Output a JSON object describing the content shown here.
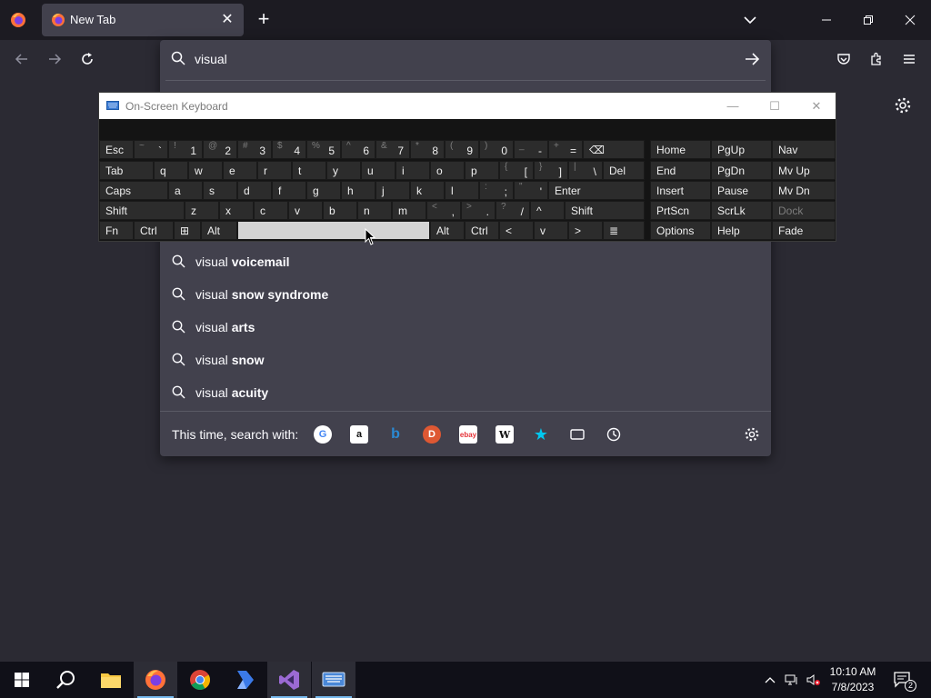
{
  "browser": {
    "tab": {
      "title": "New Tab"
    },
    "url": {
      "value": "visual"
    }
  },
  "suggestions": [
    {
      "prefix": "visual",
      "completion": "voicemail"
    },
    {
      "prefix": "visual",
      "completion": "snow syndrome"
    },
    {
      "prefix": "visual",
      "completion": "arts"
    },
    {
      "prefix": "visual",
      "completion": "snow"
    },
    {
      "prefix": "visual",
      "completion": "acuity"
    }
  ],
  "search_with": {
    "label": "This time, search with:",
    "engines": [
      "google-icon",
      "amazon-icon",
      "bing-icon",
      "duckduckgo-icon",
      "ebay-icon",
      "wikipedia-icon",
      "bookmarks-icon",
      "tabs-icon",
      "history-icon"
    ]
  },
  "osk": {
    "title": "On-Screen Keyboard",
    "rows": [
      [
        {
          "l": "Esc"
        },
        {
          "s": "~",
          "m": "`"
        },
        {
          "s": "!",
          "m": "1"
        },
        {
          "s": "@",
          "m": "2"
        },
        {
          "s": "#",
          "m": "3"
        },
        {
          "s": "$",
          "m": "4"
        },
        {
          "s": "%",
          "m": "5"
        },
        {
          "s": "^",
          "m": "6"
        },
        {
          "s": "&",
          "m": "7"
        },
        {
          "s": "*",
          "m": "8"
        },
        {
          "s": "(",
          "m": "9"
        },
        {
          "s": ")",
          "m": "0"
        },
        {
          "s": "_",
          "m": "-"
        },
        {
          "s": "+",
          "m": "="
        },
        {
          "l": "⌫"
        },
        {
          "l": "Home"
        },
        {
          "l": "PgUp"
        },
        {
          "l": "Nav"
        }
      ],
      [
        {
          "l": "Tab"
        },
        {
          "l": "q"
        },
        {
          "l": "w"
        },
        {
          "l": "e"
        },
        {
          "l": "r"
        },
        {
          "l": "t"
        },
        {
          "l": "y"
        },
        {
          "l": "u"
        },
        {
          "l": "i"
        },
        {
          "l": "o"
        },
        {
          "l": "p"
        },
        {
          "s": "{",
          "m": "["
        },
        {
          "s": "}",
          "m": "]"
        },
        {
          "s": "|",
          "m": "\\"
        },
        {
          "l": "Del"
        },
        {
          "l": "End"
        },
        {
          "l": "PgDn"
        },
        {
          "l": "Mv Up"
        }
      ],
      [
        {
          "l": "Caps"
        },
        {
          "l": "a"
        },
        {
          "l": "s"
        },
        {
          "l": "d"
        },
        {
          "l": "f"
        },
        {
          "l": "g"
        },
        {
          "l": "h"
        },
        {
          "l": "j"
        },
        {
          "l": "k"
        },
        {
          "l": "l"
        },
        {
          "s": ":",
          "m": ";"
        },
        {
          "s": "\"",
          "m": "'"
        },
        {
          "l": "Enter"
        },
        {
          "l": "Insert"
        },
        {
          "l": "Pause"
        },
        {
          "l": "Mv Dn"
        }
      ],
      [
        {
          "l": "Shift"
        },
        {
          "l": "z"
        },
        {
          "l": "x"
        },
        {
          "l": "c"
        },
        {
          "l": "v"
        },
        {
          "l": "b"
        },
        {
          "l": "n"
        },
        {
          "l": "m"
        },
        {
          "s": "<",
          "m": ","
        },
        {
          "s": ">",
          "m": "."
        },
        {
          "s": "?",
          "m": "/"
        },
        {
          "l": "^"
        },
        {
          "l": "Shift"
        },
        {
          "l": "PrtScn"
        },
        {
          "l": "ScrLk"
        },
        {
          "l": "Dock"
        }
      ],
      [
        {
          "l": "Fn"
        },
        {
          "l": "Ctrl"
        },
        {
          "l": "⊞"
        },
        {
          "l": "Alt"
        },
        {
          "l": ""
        },
        {
          "l": "Alt"
        },
        {
          "l": "Ctrl"
        },
        {
          "l": "<"
        },
        {
          "l": "v"
        },
        {
          "l": ">"
        },
        {
          "l": "≣"
        },
        {
          "l": "Options"
        },
        {
          "l": "Help"
        },
        {
          "l": "Fade"
        }
      ]
    ]
  },
  "taskbar": {
    "time": "10:10 AM",
    "date": "7/8/2023",
    "notifications": "2"
  },
  "colors": {
    "accent": "#76b9ed",
    "panel": "#42414d",
    "toolbar": "#2b2a33"
  }
}
